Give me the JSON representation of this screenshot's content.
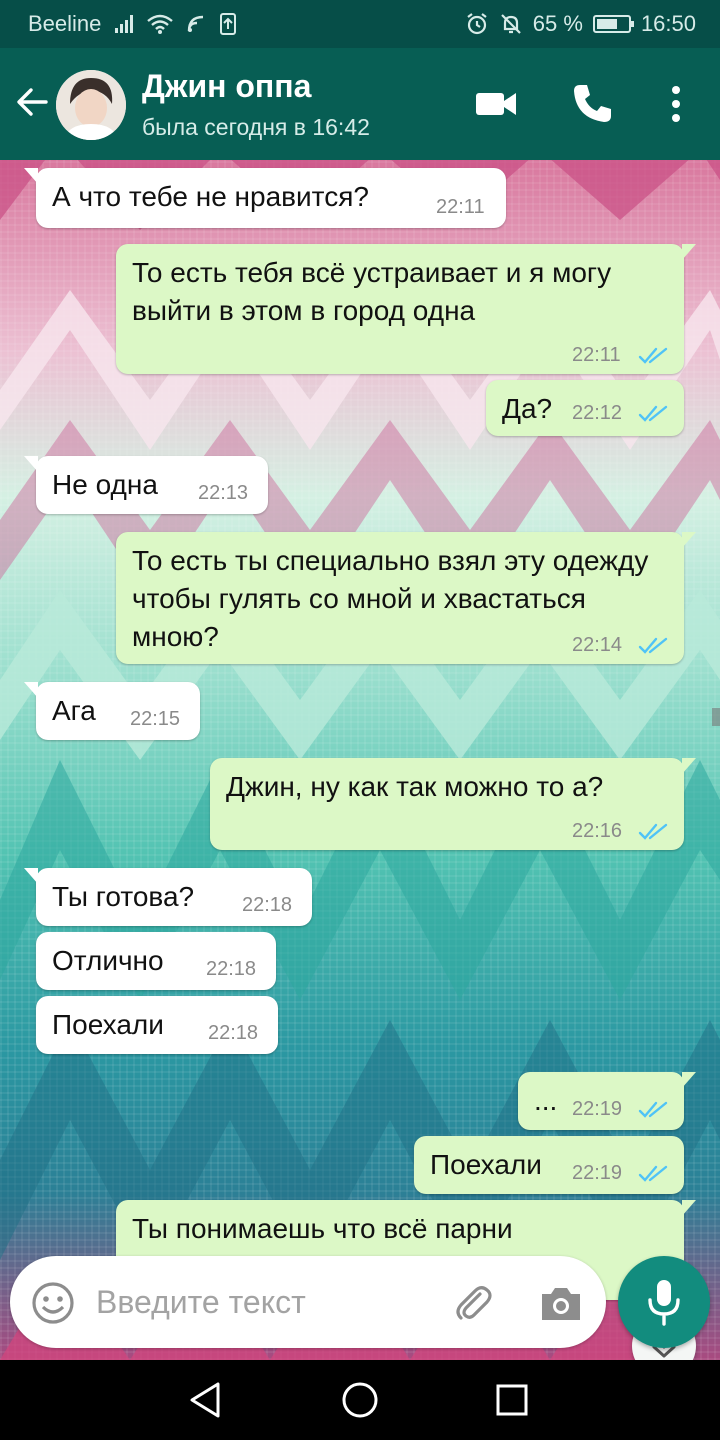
{
  "status_bar": {
    "carrier": "Beeline",
    "battery": "65 %",
    "clock": "16:50"
  },
  "header": {
    "name": "Джин оппа",
    "status": "была сегодня в 16:42",
    "icons": [
      "back-arrow-icon",
      "video-call-icon",
      "phone-icon",
      "more-vert-icon"
    ]
  },
  "messages": [
    {
      "dir": "in",
      "text": "А что тебе не нравится?",
      "time": "22:11"
    },
    {
      "dir": "out",
      "text": "То есть тебя всё устраивает и я могу выйти в этом в город одна",
      "time": "22:11",
      "read": true
    },
    {
      "dir": "out",
      "text": "Да?",
      "time": "22:12",
      "read": true
    },
    {
      "dir": "in",
      "text": "Не одна",
      "time": "22:13"
    },
    {
      "dir": "out",
      "text": "То есть ты специально взял эту одежду чтобы гулять со мной и хвастаться мною?",
      "time": "22:14",
      "read": true
    },
    {
      "dir": "in",
      "text": "Ага",
      "time": "22:15"
    },
    {
      "dir": "out",
      "text": "Джин, ну как так можно то а?",
      "time": "22:16",
      "read": true
    },
    {
      "dir": "in",
      "text": "Ты готова?",
      "time": "22:18"
    },
    {
      "dir": "in",
      "text": "Отлично",
      "time": "22:18"
    },
    {
      "dir": "in",
      "text": "Поехали",
      "time": "22:18"
    },
    {
      "dir": "out",
      "text": "...",
      "time": "22:19",
      "read": true
    },
    {
      "dir": "out",
      "text": "Поехали",
      "time": "22:19",
      "read": true
    },
    {
      "dir": "out",
      "text": "Ты понимаешь что всё парни",
      "time": ""
    }
  ],
  "composer": {
    "placeholder": "Введите текст"
  },
  "colors": {
    "header": "#075e54",
    "status_bar": "#064e48",
    "bubble_out": "#dcf8c6",
    "bubble_in": "#ffffff",
    "read_ticks": "#4fc3f7",
    "mic_button": "#128c7e"
  }
}
